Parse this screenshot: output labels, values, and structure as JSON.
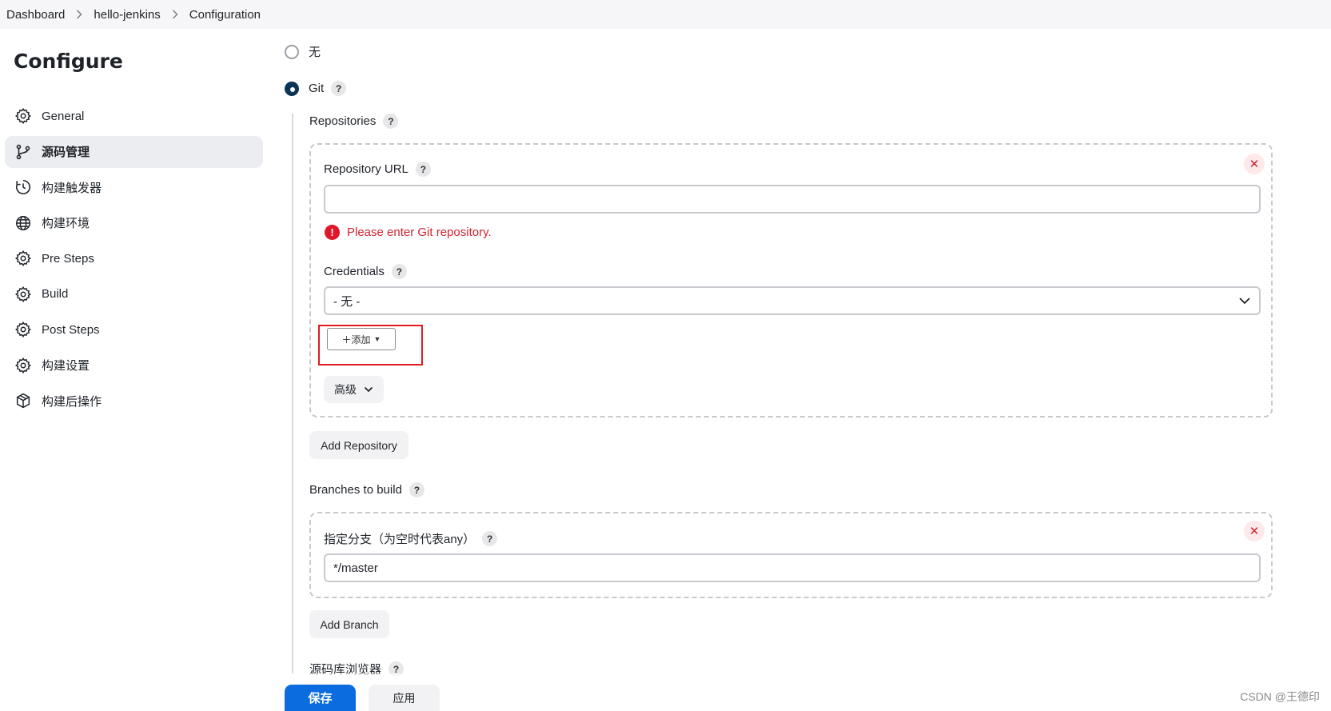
{
  "breadcrumb": [
    "Dashboard",
    "hello-jenkins",
    "Configuration"
  ],
  "page_title": "Configure",
  "sidebar": {
    "items": [
      {
        "label": "General",
        "icon": "gear-icon"
      },
      {
        "label": "源码管理",
        "icon": "branch-icon",
        "active": true
      },
      {
        "label": "构建触发器",
        "icon": "clock-icon"
      },
      {
        "label": "构建环境",
        "icon": "globe-icon"
      },
      {
        "label": "Pre Steps",
        "icon": "gear-icon"
      },
      {
        "label": "Build",
        "icon": "gear-icon"
      },
      {
        "label": "Post Steps",
        "icon": "gear-icon"
      },
      {
        "label": "构建设置",
        "icon": "gear-icon"
      },
      {
        "label": "构建后操作",
        "icon": "package-icon"
      }
    ]
  },
  "scm": {
    "none_label": "无",
    "git_label": "Git",
    "help_symbol": "?",
    "repositories_label": "Repositories",
    "repo_url_label": "Repository URL",
    "repo_url_value": "",
    "repo_url_error": "Please enter Git repository.",
    "credentials_label": "Credentials",
    "credentials_value": "- 无 -",
    "add_button": "＋添加",
    "advanced_button": "高级",
    "add_repository_button": "Add Repository",
    "branches_label": "Branches to build",
    "branch_specifier_label": "指定分支（为空时代表any）",
    "branch_value": "*/master",
    "add_branch_button": "Add Branch",
    "repo_browser_label": "源码库浏览器"
  },
  "actions": {
    "save": "保存",
    "apply": "应用"
  },
  "watermark": "CSDN @王德印",
  "colors": {
    "accent": "#0b6ce0",
    "error": "#d3232f",
    "radio": "#0c3454"
  }
}
